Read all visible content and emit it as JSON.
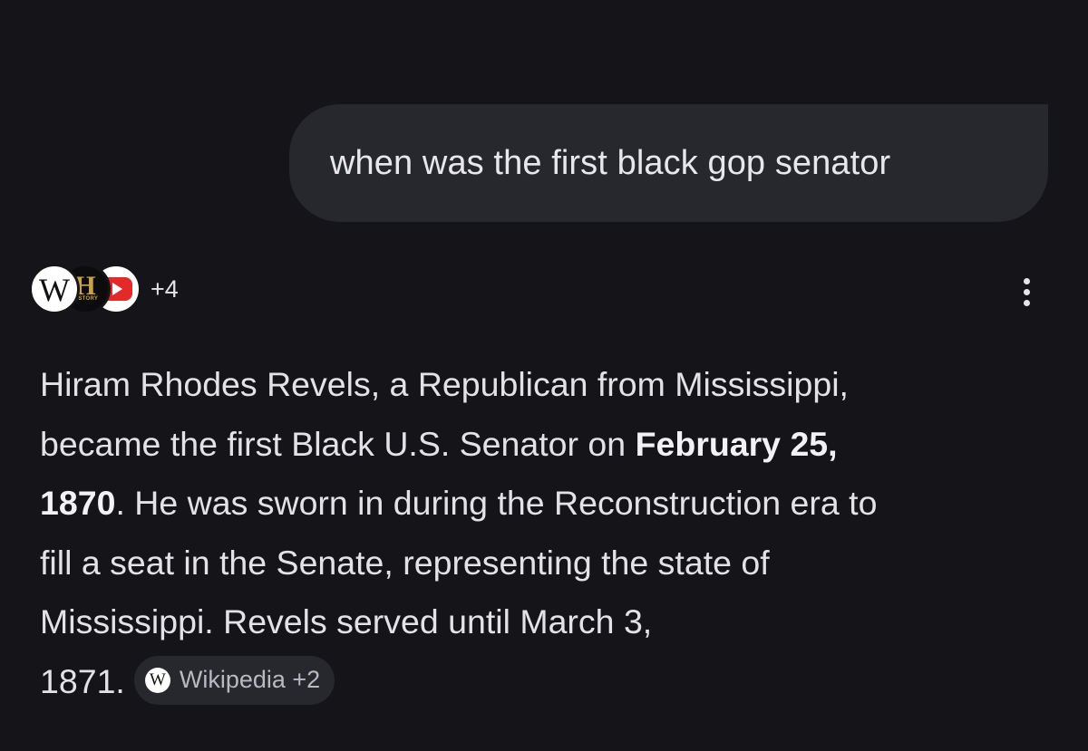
{
  "user_message": "when was the first black gop senator",
  "sources": {
    "icons": [
      {
        "name": "wikipedia-icon",
        "glyph": "W"
      },
      {
        "name": "history-icon",
        "glyph": "H",
        "sub": "HISTORY"
      },
      {
        "name": "youtube-icon"
      }
    ],
    "more_count": "+4"
  },
  "answer": {
    "line1": "Hiram Rhodes Revels, a Republican from Mississippi,",
    "line2_pre": "became the first Black U.S. Senator on ",
    "bold_date_a": "February 25,",
    "bold_date_b": "1870",
    "line3_post": ". He was sworn in during the Reconstruction era to",
    "line4": "fill a seat in the Senate, representing the state of",
    "line5": "Mississippi. Revels served until March 3,",
    "line6": "1871."
  },
  "citation_chip": {
    "icon_glyph": "W",
    "label": "Wikipedia +2"
  },
  "colors": {
    "background": "#141419",
    "bubble": "#27272e",
    "text": "#e2e2e7",
    "chip_text": "#b9b9c0",
    "youtube_red": "#e22a2a",
    "history_gold": "#c9a24a"
  }
}
